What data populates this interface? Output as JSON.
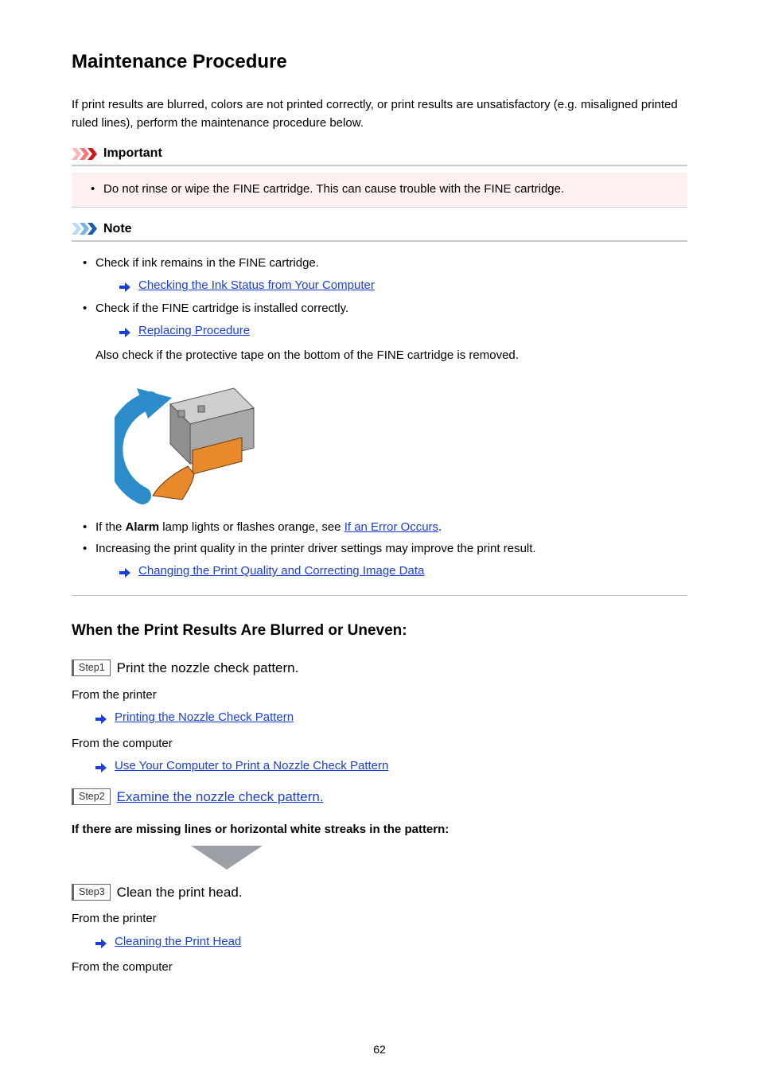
{
  "title": "Maintenance Procedure",
  "intro": "If print results are blurred, colors are not printed correctly, or print results are unsatisfactory (e.g. misaligned printed ruled lines), perform the maintenance procedure below.",
  "important": {
    "heading": "Important",
    "items": [
      "Do not rinse or wipe the FINE cartridge. This can cause trouble with the FINE cartridge."
    ]
  },
  "note": {
    "heading": "Note",
    "bullet1": "Check if ink remains in the FINE cartridge.",
    "link1": "Checking the Ink Status from Your Computer",
    "bullet2": "Check if the FINE cartridge is installed correctly.",
    "link2": "Replacing Procedure",
    "text2b": "Also check if the protective tape on the bottom of the FINE cartridge is removed.",
    "bullet3_prefix": "If the ",
    "bullet3_bold": "Alarm",
    "bullet3_mid": " lamp lights or flashes orange, see ",
    "link3": "If an Error Occurs",
    "bullet3_suffix": ".",
    "bullet4": "Increasing the print quality in the printer driver settings may improve the print result.",
    "link4": "Changing the Print Quality and Correcting Image Data"
  },
  "section_h2": "When the Print Results Are Blurred or Uneven:",
  "step1": {
    "badge": "Step1",
    "title": "Print the nozzle check pattern.",
    "from_printer": "From the printer",
    "link_printer": "Printing the Nozzle Check Pattern",
    "from_computer": "From the computer",
    "link_computer": "Use Your Computer to Print a Nozzle Check Pattern"
  },
  "step2": {
    "badge": "Step2",
    "title_link": "Examine the nozzle check pattern.",
    "condition": "If there are missing lines or horizontal white streaks in the pattern:"
  },
  "step3": {
    "badge": "Step3",
    "title": "Clean the print head.",
    "from_printer": "From the printer",
    "link_printer": "Cleaning the Print Head",
    "from_computer": "From the computer"
  },
  "page_number": "62"
}
